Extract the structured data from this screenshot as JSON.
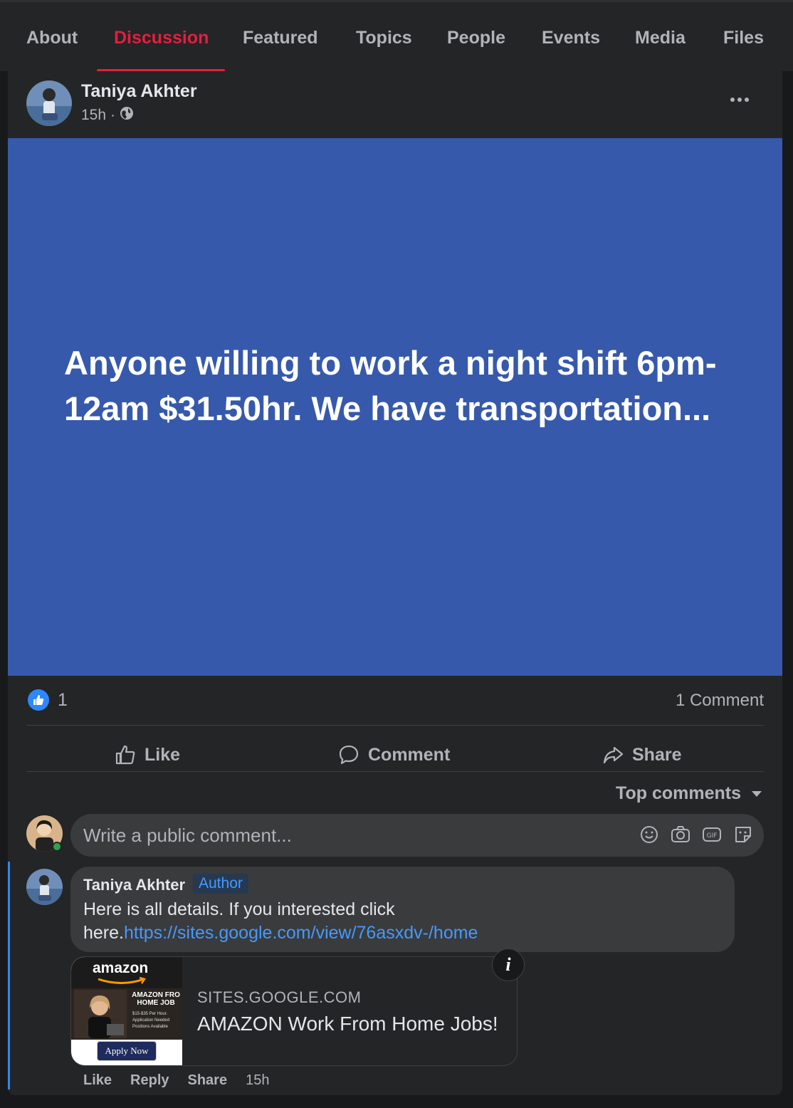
{
  "nav": {
    "tabs": [
      {
        "label": "About"
      },
      {
        "label": "Discussion"
      },
      {
        "label": "Featured"
      },
      {
        "label": "Topics"
      },
      {
        "label": "People"
      },
      {
        "label": "Events"
      },
      {
        "label": "Media"
      },
      {
        "label": "Files"
      }
    ],
    "active_tab": "Discussion",
    "accent_color": "#e41e3f"
  },
  "post": {
    "author": "Taniya Akhter",
    "time": "15h",
    "separator": "·",
    "audience_icon": "globe-icon",
    "banner_color": "#3659ab",
    "text": "Anyone willing to work a night shift 6pm-12am $31.50hr. We have transportation...",
    "reaction_count": "1",
    "comment_count": "1 Comment",
    "actions": {
      "like": "Like",
      "comment": "Comment",
      "share": "Share"
    }
  },
  "comments_section": {
    "sort_label": "Top comments",
    "input_placeholder": "Write a public comment...",
    "input_icons": [
      "emoji-icon",
      "camera-icon",
      "gif-icon",
      "sticker-icon"
    ],
    "comment": {
      "author": "Taniya Akhter",
      "badge": "Author",
      "text_before": "Here is all details. If you interested click here.",
      "link": "https://sites.google.com/view/76asxdv-/home",
      "preview": {
        "domain": "SITES.GOOGLE.COM",
        "title": "AMAZON Work From Home Jobs!",
        "thumb_brand": "amazon",
        "thumb_heading": "AMAZON FRO HOME JOB",
        "thumb_bullets": [
          "$15-$35 Per Hour.",
          "Application Needed",
          "Positions Available"
        ],
        "thumb_button": "Apply Now"
      },
      "actions": {
        "like": "Like",
        "reply": "Reply",
        "share": "Share",
        "time": "15h"
      }
    }
  }
}
